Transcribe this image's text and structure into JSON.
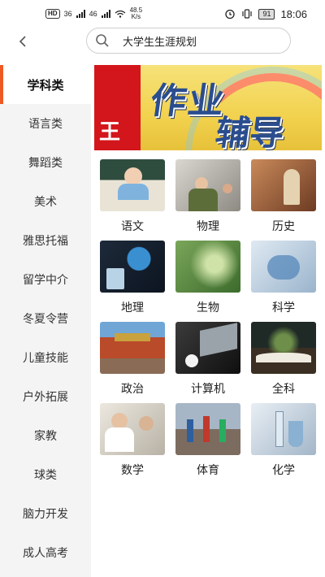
{
  "status_bar": {
    "hd_badge": "HD",
    "network_1": "36",
    "network_2": "46",
    "speed_value": "48.5",
    "speed_unit": "K/s",
    "battery": "91",
    "time": "18:06"
  },
  "header": {
    "search_text": "大学生生涯规划"
  },
  "sidebar": {
    "items": [
      {
        "label": "学科类",
        "active": true
      },
      {
        "label": "语言类"
      },
      {
        "label": "舞蹈类"
      },
      {
        "label": "美术"
      },
      {
        "label": "雅思托福"
      },
      {
        "label": "留学中介"
      },
      {
        "label": "冬夏令营"
      },
      {
        "label": "儿童技能"
      },
      {
        "label": "户外拓展"
      },
      {
        "label": "家教"
      },
      {
        "label": "球类"
      },
      {
        "label": "脑力开发"
      },
      {
        "label": "成人高考"
      }
    ]
  },
  "banner": {
    "left_text": "王",
    "main_text_1": "作业",
    "main_text_2": "辅导"
  },
  "subjects": [
    {
      "label": "语文",
      "image": "student-reading-photo"
    },
    {
      "label": "物理",
      "image": "physics-classroom-photo"
    },
    {
      "label": "历史",
      "image": "historical-painting-photo"
    },
    {
      "label": "地理",
      "image": "globe-photo"
    },
    {
      "label": "生物",
      "image": "plant-sprout-photo"
    },
    {
      "label": "科学",
      "image": "lab-experiment-photo"
    },
    {
      "label": "政治",
      "image": "forbidden-city-photo"
    },
    {
      "label": "计算机",
      "image": "laptop-coffee-photo"
    },
    {
      "label": "全科",
      "image": "open-book-plant-photo"
    },
    {
      "label": "数学",
      "image": "students-classroom-photo"
    },
    {
      "label": "体育",
      "image": "children-sports-photo"
    },
    {
      "label": "化学",
      "image": "chemistry-lab-photo"
    }
  ]
}
